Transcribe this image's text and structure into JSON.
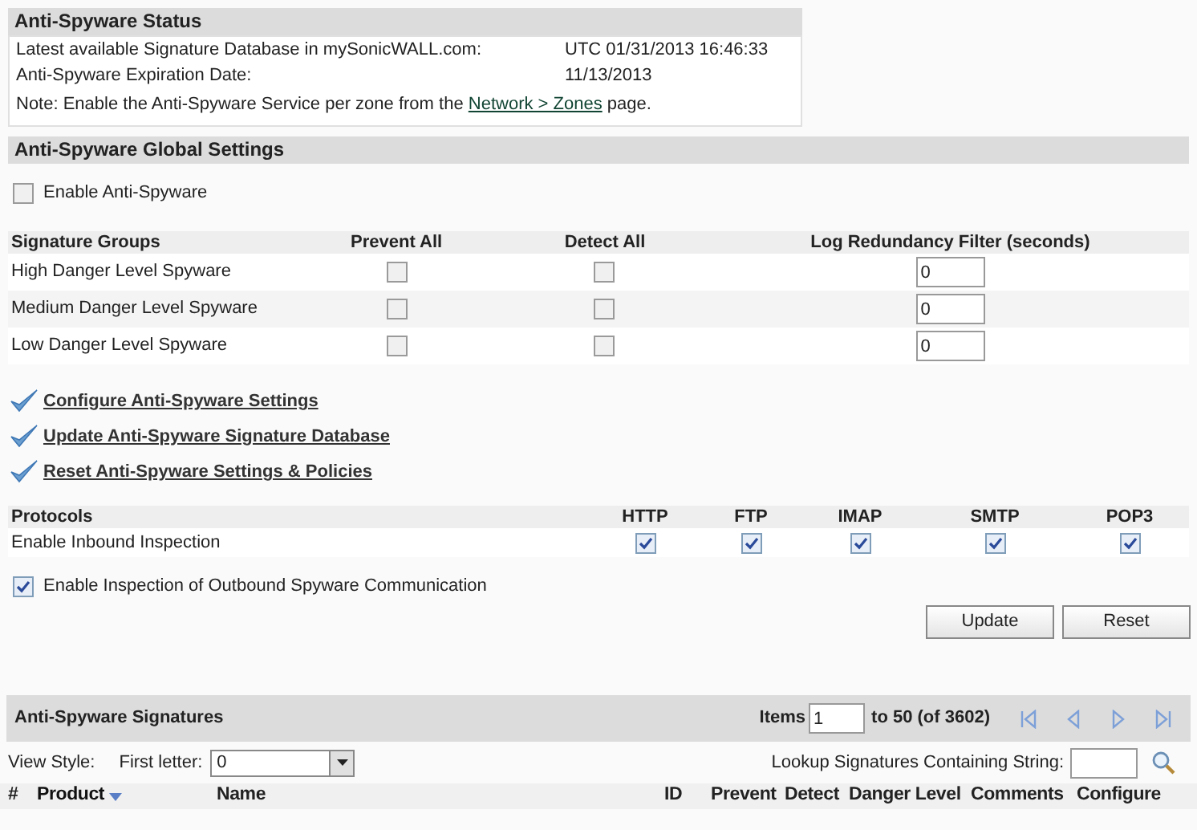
{
  "status": {
    "title": "Anti-Spyware Status",
    "rows": [
      {
        "label": "Latest available Signature Database in mySonicWALL.com:",
        "value": "UTC 01/31/2013 16:46:33"
      },
      {
        "label": "Anti-Spyware Expiration Date:",
        "value": "11/13/2013"
      }
    ],
    "note": {
      "before": "Note: Enable the Anti-Spyware Service per zone from the",
      "link": "Network > Zones",
      "after": "page."
    }
  },
  "global": {
    "title": "Anti-Spyware Global Settings",
    "enable": {
      "label": "Enable Anti-Spyware",
      "checked": false
    },
    "group_columns": [
      "Signature Groups",
      "Prevent All",
      "Detect All",
      "Log Redundancy Filter (seconds)"
    ],
    "groups": [
      {
        "name": "High Danger Level Spyware",
        "prevent": false,
        "detect": false,
        "filter": "0"
      },
      {
        "name": "Medium Danger Level Spyware",
        "prevent": false,
        "detect": false,
        "filter": "0"
      },
      {
        "name": "Low Danger Level Spyware",
        "prevent": false,
        "detect": false,
        "filter": "0"
      }
    ],
    "links": [
      "Configure Anti-Spyware Settings",
      "Update Anti-Spyware Signature Database",
      "Reset Anti-Spyware Settings & Policies"
    ],
    "protocol_columns": [
      "Protocols",
      "HTTP",
      "FTP",
      "IMAP",
      "SMTP",
      "POP3"
    ],
    "inbound": {
      "label": "Enable Inbound Inspection",
      "checks": [
        {
          "checked": true
        },
        {
          "checked": true
        },
        {
          "checked": true
        },
        {
          "checked": true
        },
        {
          "checked": true
        }
      ]
    },
    "outbound": {
      "label": "Enable Inspection of Outbound Spyware Communication",
      "checked": true
    },
    "buttons": [
      "Update",
      "Reset"
    ]
  },
  "signatures": {
    "title": "Anti-Spyware Signatures",
    "items_label": "Items",
    "items_value": "1",
    "range": "to 50 (of 3602)",
    "view_style": "View Style:",
    "first_letter_label": "First letter:",
    "first_letter": "0",
    "lookup_label": "Lookup Signatures Containing String:",
    "columns": [
      {
        "label": "#",
        "sorted": false
      },
      {
        "label": "Product",
        "sorted": true
      },
      {
        "label": "Name",
        "sorted": false
      },
      {
        "label": "ID",
        "sorted": false
      },
      {
        "label": "Prevent",
        "sorted": false
      },
      {
        "label": "Detect",
        "sorted": false
      },
      {
        "label": "Danger Level",
        "sorted": false
      },
      {
        "label": "Comments",
        "sorted": false
      },
      {
        "label": "Configure",
        "sorted": false
      }
    ]
  }
}
